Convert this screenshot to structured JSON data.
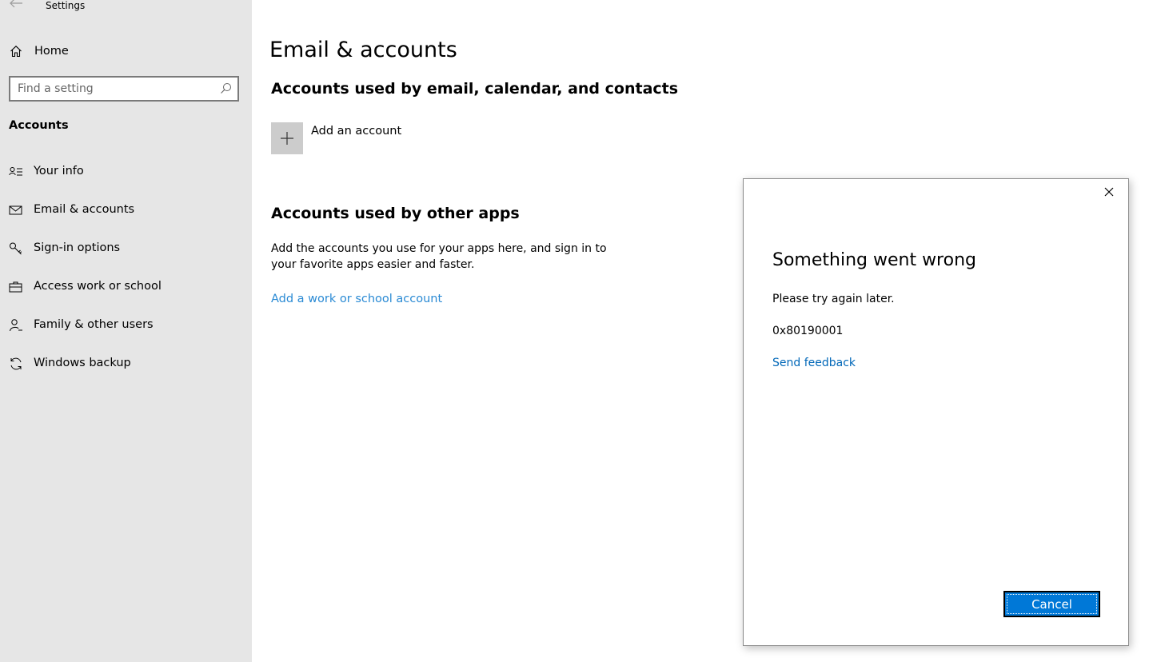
{
  "window": {
    "title": "Settings"
  },
  "sidebar": {
    "home_label": "Home",
    "search_placeholder": "Find a setting",
    "section": "Accounts",
    "items": [
      {
        "label": "Your info",
        "icon": "person-card-icon"
      },
      {
        "label": "Email & accounts",
        "icon": "mail-icon"
      },
      {
        "label": "Sign-in options",
        "icon": "key-icon"
      },
      {
        "label": "Access work or school",
        "icon": "briefcase-icon"
      },
      {
        "label": "Family & other users",
        "icon": "person-add-icon"
      },
      {
        "label": "Windows backup",
        "icon": "sync-icon"
      }
    ]
  },
  "main": {
    "title": "Email & accounts",
    "section1_heading": "Accounts used by email, calendar, and contacts",
    "add_account_label": "Add an account",
    "section2_heading": "Accounts used by other apps",
    "section2_description": "Add the accounts you use for your apps here, and sign in to your favorite apps easier and faster.",
    "add_work_link": "Add a work or school account"
  },
  "dialog": {
    "title": "Something went wrong",
    "message": "Please try again later.",
    "error_code": "0x80190001",
    "feedback_link": "Send feedback",
    "cancel_label": "Cancel"
  },
  "colors": {
    "sidebar_bg": "#e6e6e6",
    "link": "#2a8ad4",
    "accent_button": "#0078d7"
  }
}
